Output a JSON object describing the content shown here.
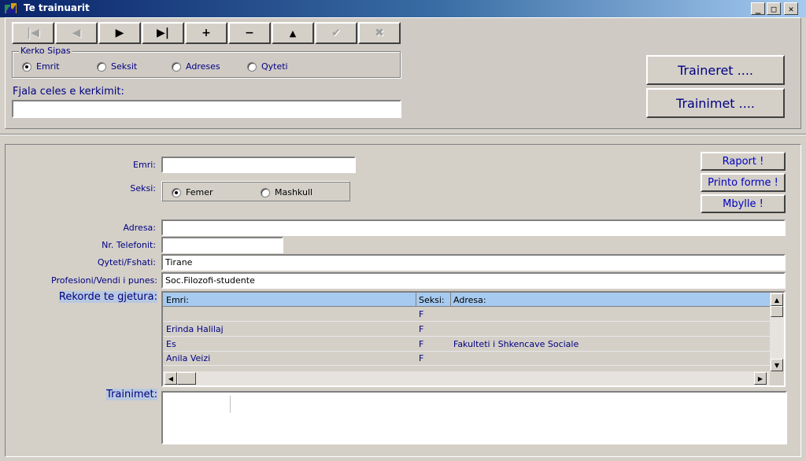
{
  "window": {
    "title": "Te trainuarit"
  },
  "nav": {
    "first": "|◀",
    "prev": "◀",
    "next": "▶",
    "last": "▶|",
    "add": "+",
    "remove": "−",
    "up": "▲",
    "save": "✔",
    "cancel": "✖"
  },
  "search": {
    "group_label": "Kerko Sipas",
    "options": [
      "Emrit",
      "Seksit",
      "Adreses",
      "Qyteti"
    ],
    "selected": "Emrit",
    "keyword_label": "Fjala celes e kerkimit:",
    "keyword_value": ""
  },
  "top_buttons": {
    "trainers": "Traineret ....",
    "trainings": "Trainimet ...."
  },
  "side_buttons": {
    "report": "Raport !",
    "print": "Printo forme !",
    "close": "Mbylle !"
  },
  "form": {
    "name_label": "Emri:",
    "name_value": "",
    "gender_label": "Seksi:",
    "gender_options": [
      "Femer",
      "Mashkull"
    ],
    "gender_selected": "Femer",
    "address_label": "Adresa:",
    "address_value": "",
    "phone_label": "Nr. Telefonit:",
    "phone_value": "",
    "city_label": "Qyteti/Fshati:",
    "city_value": "Tirane",
    "profession_label": "Profesioni/Vendi i punes:",
    "profession_value": "Soc.Filozofi-studente"
  },
  "records": {
    "label": "Rekorde te gjetura:",
    "columns": [
      "Emri:",
      "Seksi:",
      "Adresa:"
    ],
    "rows": [
      [
        "",
        "F",
        ""
      ],
      [
        "Erinda Halilaj",
        "F",
        ""
      ],
      [
        "Es",
        "F",
        "Fakulteti i Shkencave Sociale"
      ],
      [
        "Anila Veizi",
        "F",
        ""
      ]
    ]
  },
  "trainings": {
    "label": "Trainimet:"
  },
  "colors": {
    "titlebar": "#0a246a",
    "accent": "#000080",
    "grid_header": "#a6caf0"
  }
}
